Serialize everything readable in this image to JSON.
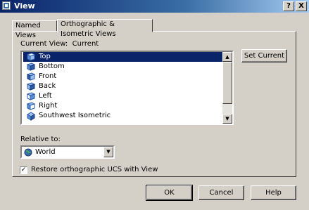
{
  "window": {
    "title": "View",
    "help_label": "?",
    "close_label": "X"
  },
  "tabs": [
    {
      "label": "Named Views",
      "active": false
    },
    {
      "label": "Orthographic & Isometric Views",
      "active": true
    }
  ],
  "current_view": {
    "label": "Current View:",
    "value": "Current"
  },
  "views": [
    {
      "label": "Top",
      "icon": "top-view-icon",
      "selected": true
    },
    {
      "label": "Bottom",
      "icon": "bottom-view-icon",
      "selected": false
    },
    {
      "label": "Front",
      "icon": "front-view-icon",
      "selected": false
    },
    {
      "label": "Back",
      "icon": "back-view-icon",
      "selected": false
    },
    {
      "label": "Left",
      "icon": "left-view-icon",
      "selected": false
    },
    {
      "label": "Right",
      "icon": "right-view-icon",
      "selected": false
    },
    {
      "label": "Southwest Isometric",
      "icon": "southwest-isometric-icon",
      "selected": false
    }
  ],
  "set_current_label": "Set Current",
  "relative_to": {
    "label": "Relative to:",
    "value": "World",
    "icon": "globe-icon"
  },
  "restore_checkbox": {
    "label": "Restore orthographic UCS with View",
    "checked": true,
    "check_glyph": "✓"
  },
  "buttons": {
    "ok": "OK",
    "cancel": "Cancel",
    "help": "Help"
  },
  "colors": {
    "selection": "#0a246a",
    "face": "#d4d0c8",
    "title_start": "#0a246a"
  }
}
